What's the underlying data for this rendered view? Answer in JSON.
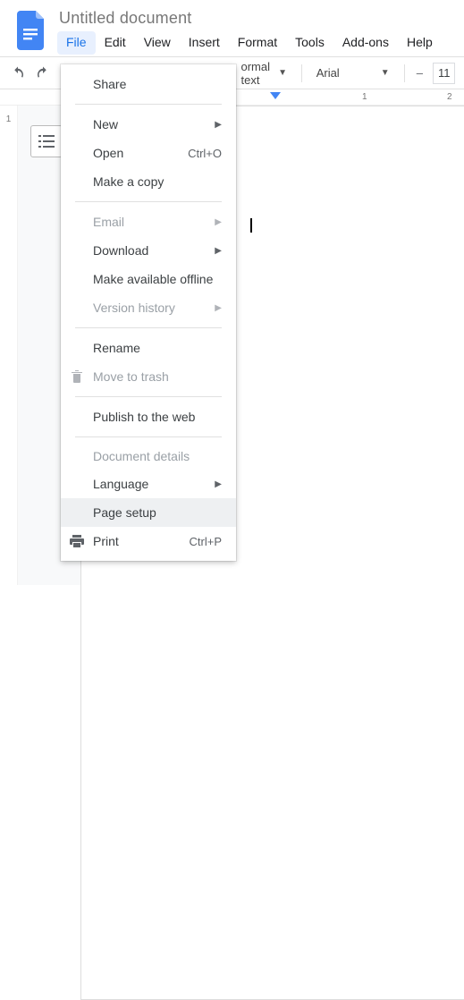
{
  "header": {
    "doc_title": "Untitled document",
    "menu": {
      "file": "File",
      "edit": "Edit",
      "view": "View",
      "insert": "Insert",
      "format": "Format",
      "tools": "Tools",
      "addons": "Add-ons",
      "help": "Help"
    }
  },
  "toolbar": {
    "style_combo": "ormal text",
    "font_combo": "Arial",
    "font_size": "11",
    "minus": "–"
  },
  "ruler": {
    "v_one": "1",
    "h_one": "1",
    "h_two": "2"
  },
  "menuitems": {
    "share": "Share",
    "new": "New",
    "open": "Open",
    "open_shortcut": "Ctrl+O",
    "make_copy": "Make a copy",
    "email": "Email",
    "download": "Download",
    "offline": "Make available offline",
    "version_history": "Version history",
    "rename": "Rename",
    "move_trash": "Move to trash",
    "publish_web": "Publish to the web",
    "doc_details": "Document details",
    "language": "Language",
    "page_setup": "Page setup",
    "print": "Print",
    "print_shortcut": "Ctrl+P"
  }
}
